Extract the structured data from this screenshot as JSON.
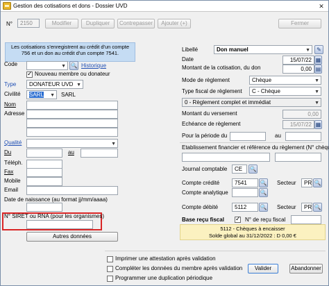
{
  "window": {
    "title": "Gestion des cotisations et dons - Dossier UVD"
  },
  "toolbar": {
    "number_label": "N°",
    "number_value": "2150",
    "modifier": "Modifier",
    "dupliquer": "Dupliquer",
    "contrepasser": "Contrepasser",
    "ajouter": "Ajouter (+)",
    "fermer": "Fermer"
  },
  "info": {
    "line1": "Les cotisations s'enregistrent au crédit d'un compte",
    "line2": "756 et un don au crédit d'un compte 7541."
  },
  "left": {
    "code_label": "Code",
    "historique": "Historique",
    "nouveau_membre": "Nouveau membre ou donateur",
    "type_label": "Type",
    "type_value": "DONATEUR UVD",
    "civilite_label": "Civilité",
    "civilite_value": "SARL",
    "civilite_text": "SARL",
    "nom_label": "Nom",
    "adresse_label": "Adresse",
    "qualite_label": "Qualité",
    "du_label": "Du",
    "au_label": "au",
    "telephone_label": "Téléph.",
    "fax_label": "Fax",
    "mobile_label": "Mobile",
    "email_label": "Email",
    "naissance_label": "Date de naissance (au format jj/mm/aaaa)",
    "siret_label": "N° SIRET ou RNA (pour les organismes)",
    "autres_donnees": "Autres données"
  },
  "right": {
    "libelle_label": "Libellé",
    "libelle_value": "Don manuel",
    "date_label": "Date",
    "date_value": "15/07/22",
    "montant_label": "Montant de la cotisation, du don",
    "montant_value": "0,00",
    "mode_label": "Mode de règlement",
    "mode_value": "Chèque",
    "type_fiscal_label": "Type fiscal de règlement",
    "type_fiscal_value": "C - Chèque",
    "reglement_value": "0 - Règlement complet et immédiat",
    "montant_versement_label": "Montant du versement",
    "montant_versement_value": "0,00",
    "echeance_label": "Echéance de règlement",
    "echeance_value": "15/07/22",
    "periode_label": "Pour la période du",
    "periode_au": "au",
    "etablissement_label": "Etablissement financier et référence du règlement (N° chèque",
    "journal_label": "Journal comptable",
    "journal_value": "CE",
    "compte_credite_label": "Compte crédité",
    "compte_credite_value": "7541",
    "secteur_label": "Secteur",
    "secteur_value": "PR",
    "compte_analytique_label": "Compte analytique",
    "compte_debite_label": "Compte débité",
    "compte_debite_value": "5112",
    "secteur2_label": "Secteur",
    "secteur2_value": "PR",
    "base_recu_label": "Base reçu fiscal",
    "recu_fiscal_label": "N° de reçu fiscal",
    "yellow_line1": "5112 - Chèques à encaisser",
    "yellow_line2": "Solde global au 31/12/2022 : D 0,00 €"
  },
  "bottom": {
    "imprimer": "Imprimer une attestation après validation",
    "completer": "Compléter les données du membre après validation",
    "programmer": "Programmer une duplication périodique",
    "valider": "Valider",
    "abandonner": "Abandonner"
  },
  "icons": {
    "app": "folder-icon",
    "close": "close-icon",
    "calendar": "calendar-icon",
    "search": "search-icon",
    "edit": "edit-icon"
  }
}
